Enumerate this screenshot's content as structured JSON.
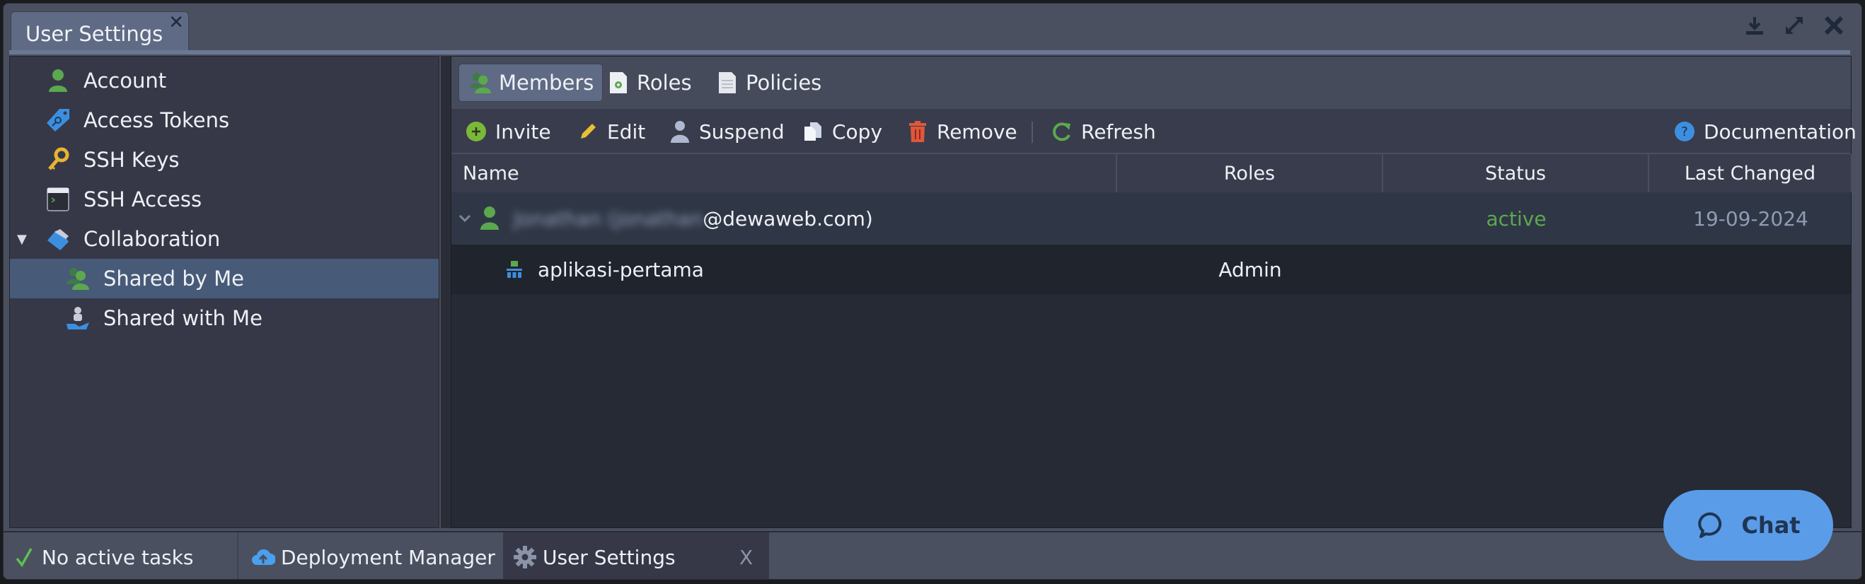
{
  "window": {
    "tab_title": "User Settings",
    "tab_close": "✕",
    "controls": [
      "download-icon",
      "maximize-icon",
      "close-icon"
    ]
  },
  "sidebar": {
    "items": [
      {
        "label": "Account",
        "icon": "user-icon",
        "level": 0
      },
      {
        "label": "Access Tokens",
        "icon": "tag-key-icon",
        "level": 0
      },
      {
        "label": "SSH Keys",
        "icon": "key-icon",
        "level": 0
      },
      {
        "label": "SSH Access",
        "icon": "terminal-icon",
        "level": 0
      },
      {
        "label": "Collaboration",
        "icon": "handshake-icon",
        "level": 0,
        "expanded": true
      },
      {
        "label": "Shared by Me",
        "icon": "users-icon",
        "level": 1,
        "selected": true
      },
      {
        "label": "Shared with Me",
        "icon": "hand-user-icon",
        "level": 1
      }
    ]
  },
  "subtabs": [
    {
      "label": "Members",
      "icon": "users-icon",
      "active": true
    },
    {
      "label": "Roles",
      "icon": "role-doc-icon",
      "active": false
    },
    {
      "label": "Policies",
      "icon": "document-icon",
      "active": false
    }
  ],
  "toolbar": {
    "invite": "Invite",
    "edit": "Edit",
    "suspend": "Suspend",
    "copy": "Copy",
    "remove": "Remove",
    "refresh": "Refresh",
    "documentation": "Documentation"
  },
  "table": {
    "columns": [
      "Name",
      "Roles",
      "Status",
      "Last Changed"
    ],
    "rows": [
      {
        "name_blurred": "Jonathan (jonathan",
        "name_visible": "@dewaweb.com)",
        "roles": "",
        "status": "active",
        "last_changed": "19-09-2024",
        "expanded": true,
        "children": [
          {
            "name": "aplikasi-pertama",
            "roles": "Admin",
            "status": "",
            "last_changed": ""
          }
        ]
      }
    ]
  },
  "footer": {
    "tasks": "No active tasks",
    "deployment_manager": "Deployment Manager",
    "user_settings": "User Settings",
    "close": "X"
  },
  "chat": {
    "label": "Chat"
  },
  "colors": {
    "accent_green": "#5ca84e",
    "selected_row": "#475a78",
    "chat_blue": "#5b9ce8",
    "remove_red": "#e0573a"
  }
}
